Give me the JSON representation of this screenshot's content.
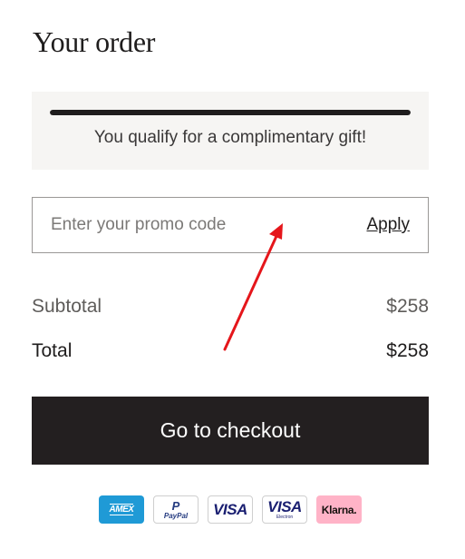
{
  "page": {
    "title": "Your order"
  },
  "gift": {
    "message": "You qualify for a complimentary gift!",
    "progress": 1.0
  },
  "promo": {
    "placeholder": "Enter your promo code",
    "value": "",
    "apply_label": "Apply"
  },
  "summary": {
    "subtotal_label": "Subtotal",
    "subtotal_value": "$258",
    "total_label": "Total",
    "total_value": "$258"
  },
  "checkout": {
    "label": "Go to checkout"
  },
  "payment_methods": {
    "amex": "AMEX",
    "paypal_mark": "P",
    "paypal_name": "PayPal",
    "visa": "VISA",
    "visa_electron": "VISA",
    "visa_electron_sub": "Electron",
    "klarna": "Klarna."
  },
  "colors": {
    "checkout_bg": "#231f20",
    "gift_box_bg": "#f6f5f3",
    "annotation_arrow": "#e5161b",
    "amex_blue": "#1f9ad6",
    "klarna_pink": "#ffb3c7"
  }
}
